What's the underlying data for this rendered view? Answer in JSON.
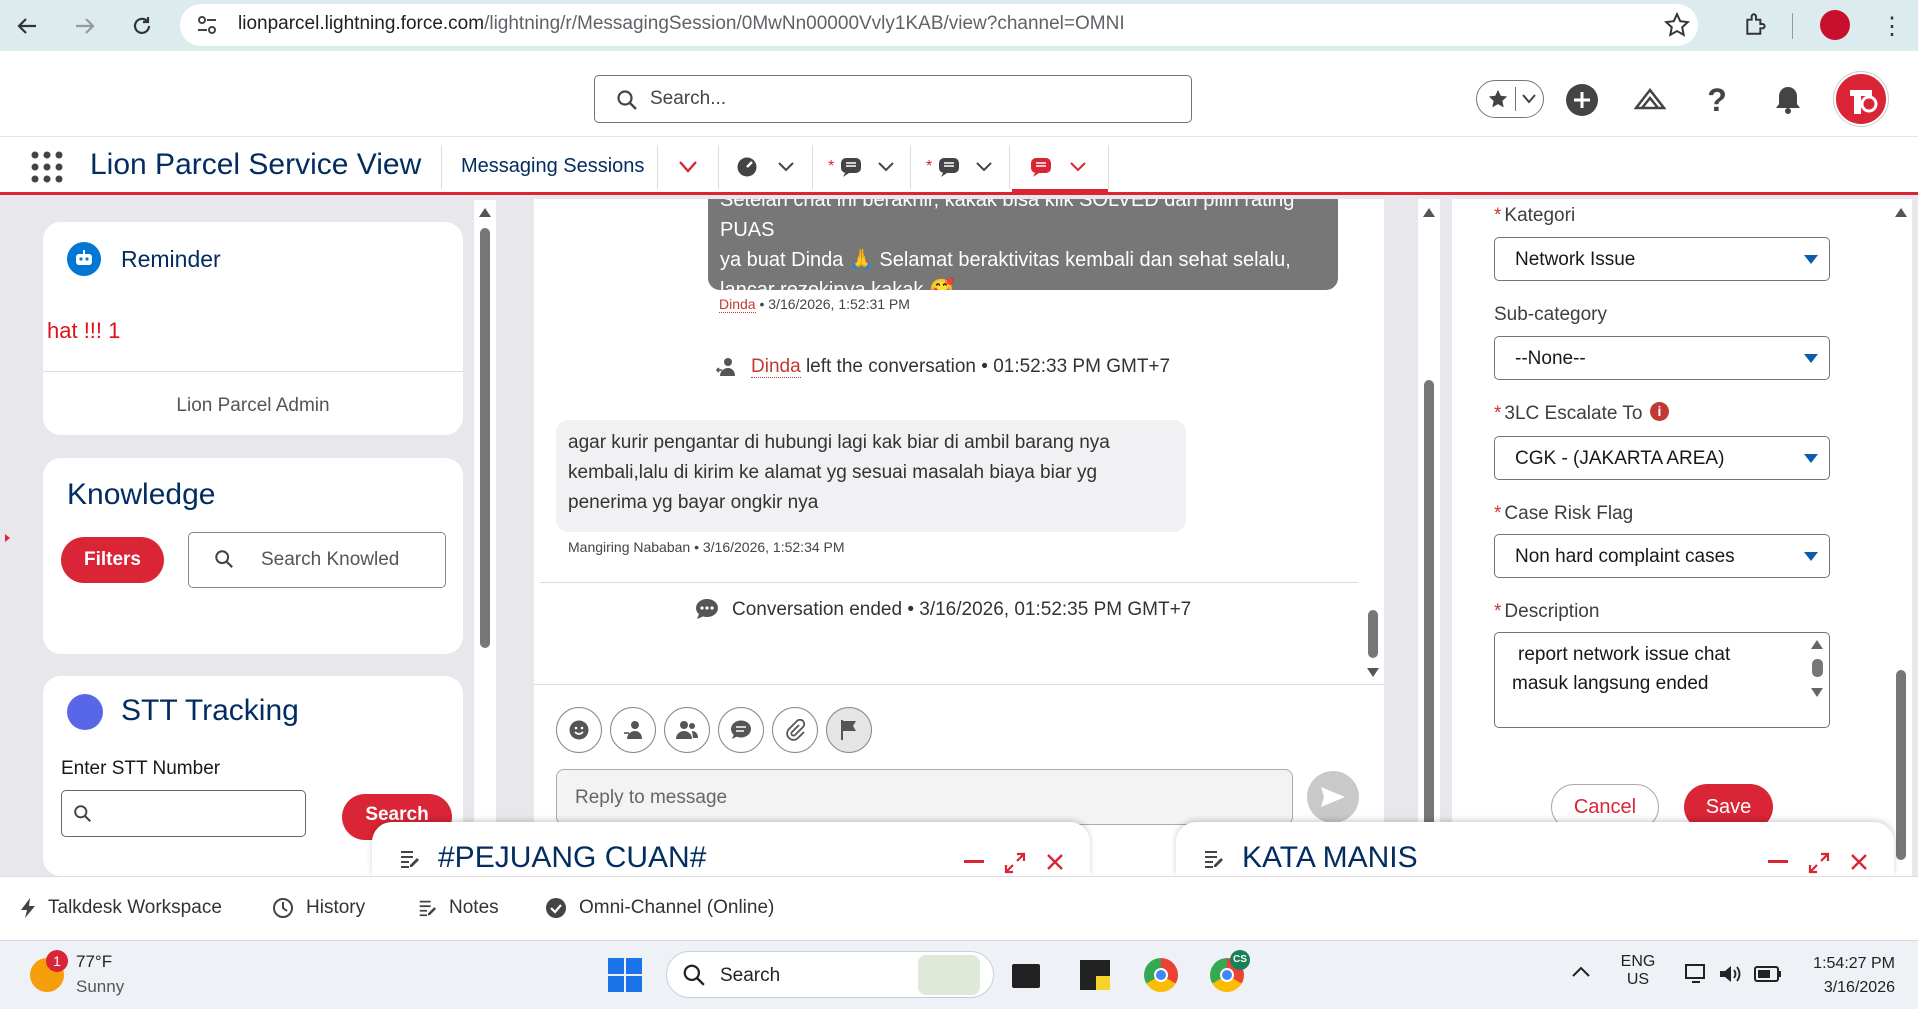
{
  "browser": {
    "url_host": "lionparcel.lightning.force.com",
    "url_path": "/lightning/r/MessagingSession/0MwNn00000Vvly1KAB/view?channel=OMNI"
  },
  "header": {
    "search_placeholder": "Search..."
  },
  "nav": {
    "app_name": "Lion Parcel Service View",
    "tab_label": "Messaging Sessions",
    "unsaved_marker": "*"
  },
  "reminder": {
    "title": "Reminder",
    "message": "hat !!! 1",
    "footer": "Lion Parcel Admin"
  },
  "knowledge": {
    "title": "Knowledge",
    "filters_label": "Filters",
    "search_placeholder": "Search Knowled"
  },
  "stt": {
    "title": "STT Tracking",
    "input_label": "Enter STT Number",
    "search_label": "Search"
  },
  "chat": {
    "outgoing": {
      "line1": "Setelah chat ini berakhir, kakak bisa klik SOLVED dan pilih rating PUAS",
      "line2": "ya buat Dinda 🙏 Selamat beraktivitas kembali dan sehat selalu,",
      "line3": "lancar rezekinya kakak 🥰",
      "author": "Dinda",
      "time": " • 3/16/2026, 1:52:31 PM"
    },
    "event_left": {
      "name": "Dinda",
      "text": "left the conversation • 01:52:33 PM GMT+7"
    },
    "incoming": {
      "line1": "agar kurir pengantar di hubungi lagi kak biar di ambil barang nya",
      "line2": "kembali,lalu di kirim ke alamat yg sesuai masalah biaya biar yg",
      "line3": "penerima yg bayar ongkir nya",
      "meta": "Mangiring Nababan • 3/16/2026, 1:52:34 PM"
    },
    "ended": "Conversation ended • 3/16/2026, 01:52:35 PM GMT+7",
    "reply_placeholder": "Reply to message"
  },
  "form": {
    "kategori_label": "Kategori",
    "kategori_value": "Network Issue",
    "subcategory_label": "Sub-category",
    "subcategory_value": "--None--",
    "escalate_label": "3LC Escalate To",
    "escalate_value": "CGK - (JAKARTA AREA)",
    "risk_label": "Case Risk Flag",
    "risk_value": "Non hard complaint cases",
    "description_label": "Description",
    "description_value": "report network issue chat masuk langsung ended",
    "cancel_label": "Cancel",
    "save_label": "Save",
    "required_marker": "*"
  },
  "popups": {
    "left_title": "#PEJUANG CUAN#",
    "right_title": "KATA MANIS"
  },
  "utility_bar": {
    "items": [
      "Talkdesk Workspace",
      "History",
      "Notes",
      "Omni-Channel (Online)"
    ]
  },
  "taskbar": {
    "weather_temp": "77°F",
    "weather_desc": "Sunny",
    "weather_badge": "1",
    "search_label": "Search",
    "lang_line1": "ENG",
    "lang_line2": "US",
    "clock_time": "1:54:27 PM",
    "clock_date": "3/16/2026",
    "chrome_badge": "CS"
  },
  "colors": {
    "brand_red": "#d92535",
    "navy": "#032d60",
    "link_blue": "#0b5cab",
    "stt_dot": "#5867e8",
    "reminder_icon": "#0176d3"
  }
}
